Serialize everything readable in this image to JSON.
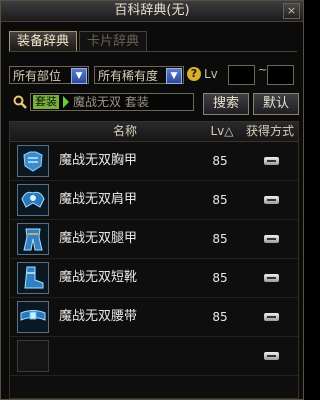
{
  "window": {
    "title": "百科辞典(无)",
    "close": "×"
  },
  "tabs": [
    {
      "label": "装备辞典",
      "active": true
    },
    {
      "label": "卡片辞典",
      "active": false
    }
  ],
  "filters": {
    "part": "所有部位",
    "rarity": "所有稀有度",
    "help": "?",
    "lv_label": "Lv",
    "lv_min": "",
    "lv_max": "",
    "range_sep": "~"
  },
  "search": {
    "tag": "套装",
    "text": "魔战无双  套装",
    "search_button": "搜索",
    "default_button": "默认"
  },
  "table": {
    "headers": {
      "name": "名称",
      "lv": "Lv△",
      "source": "获得方式"
    },
    "rows": [
      {
        "name": "魔战无双胸甲",
        "lv": "85",
        "icon": "chest-armor-icon"
      },
      {
        "name": "魔战无双肩甲",
        "lv": "85",
        "icon": "shoulder-armor-icon"
      },
      {
        "name": "魔战无双腿甲",
        "lv": "85",
        "icon": "leg-armor-icon"
      },
      {
        "name": "魔战无双短靴",
        "lv": "85",
        "icon": "boots-icon"
      },
      {
        "name": "魔战无双腰带",
        "lv": "85",
        "icon": "belt-icon"
      },
      {
        "name": "",
        "lv": "",
        "icon": "empty-slot-icon"
      }
    ]
  },
  "colors": {
    "accent_blue": "#2a4a9a",
    "tag_green": "#7ab040",
    "gold": "#d8b030"
  }
}
